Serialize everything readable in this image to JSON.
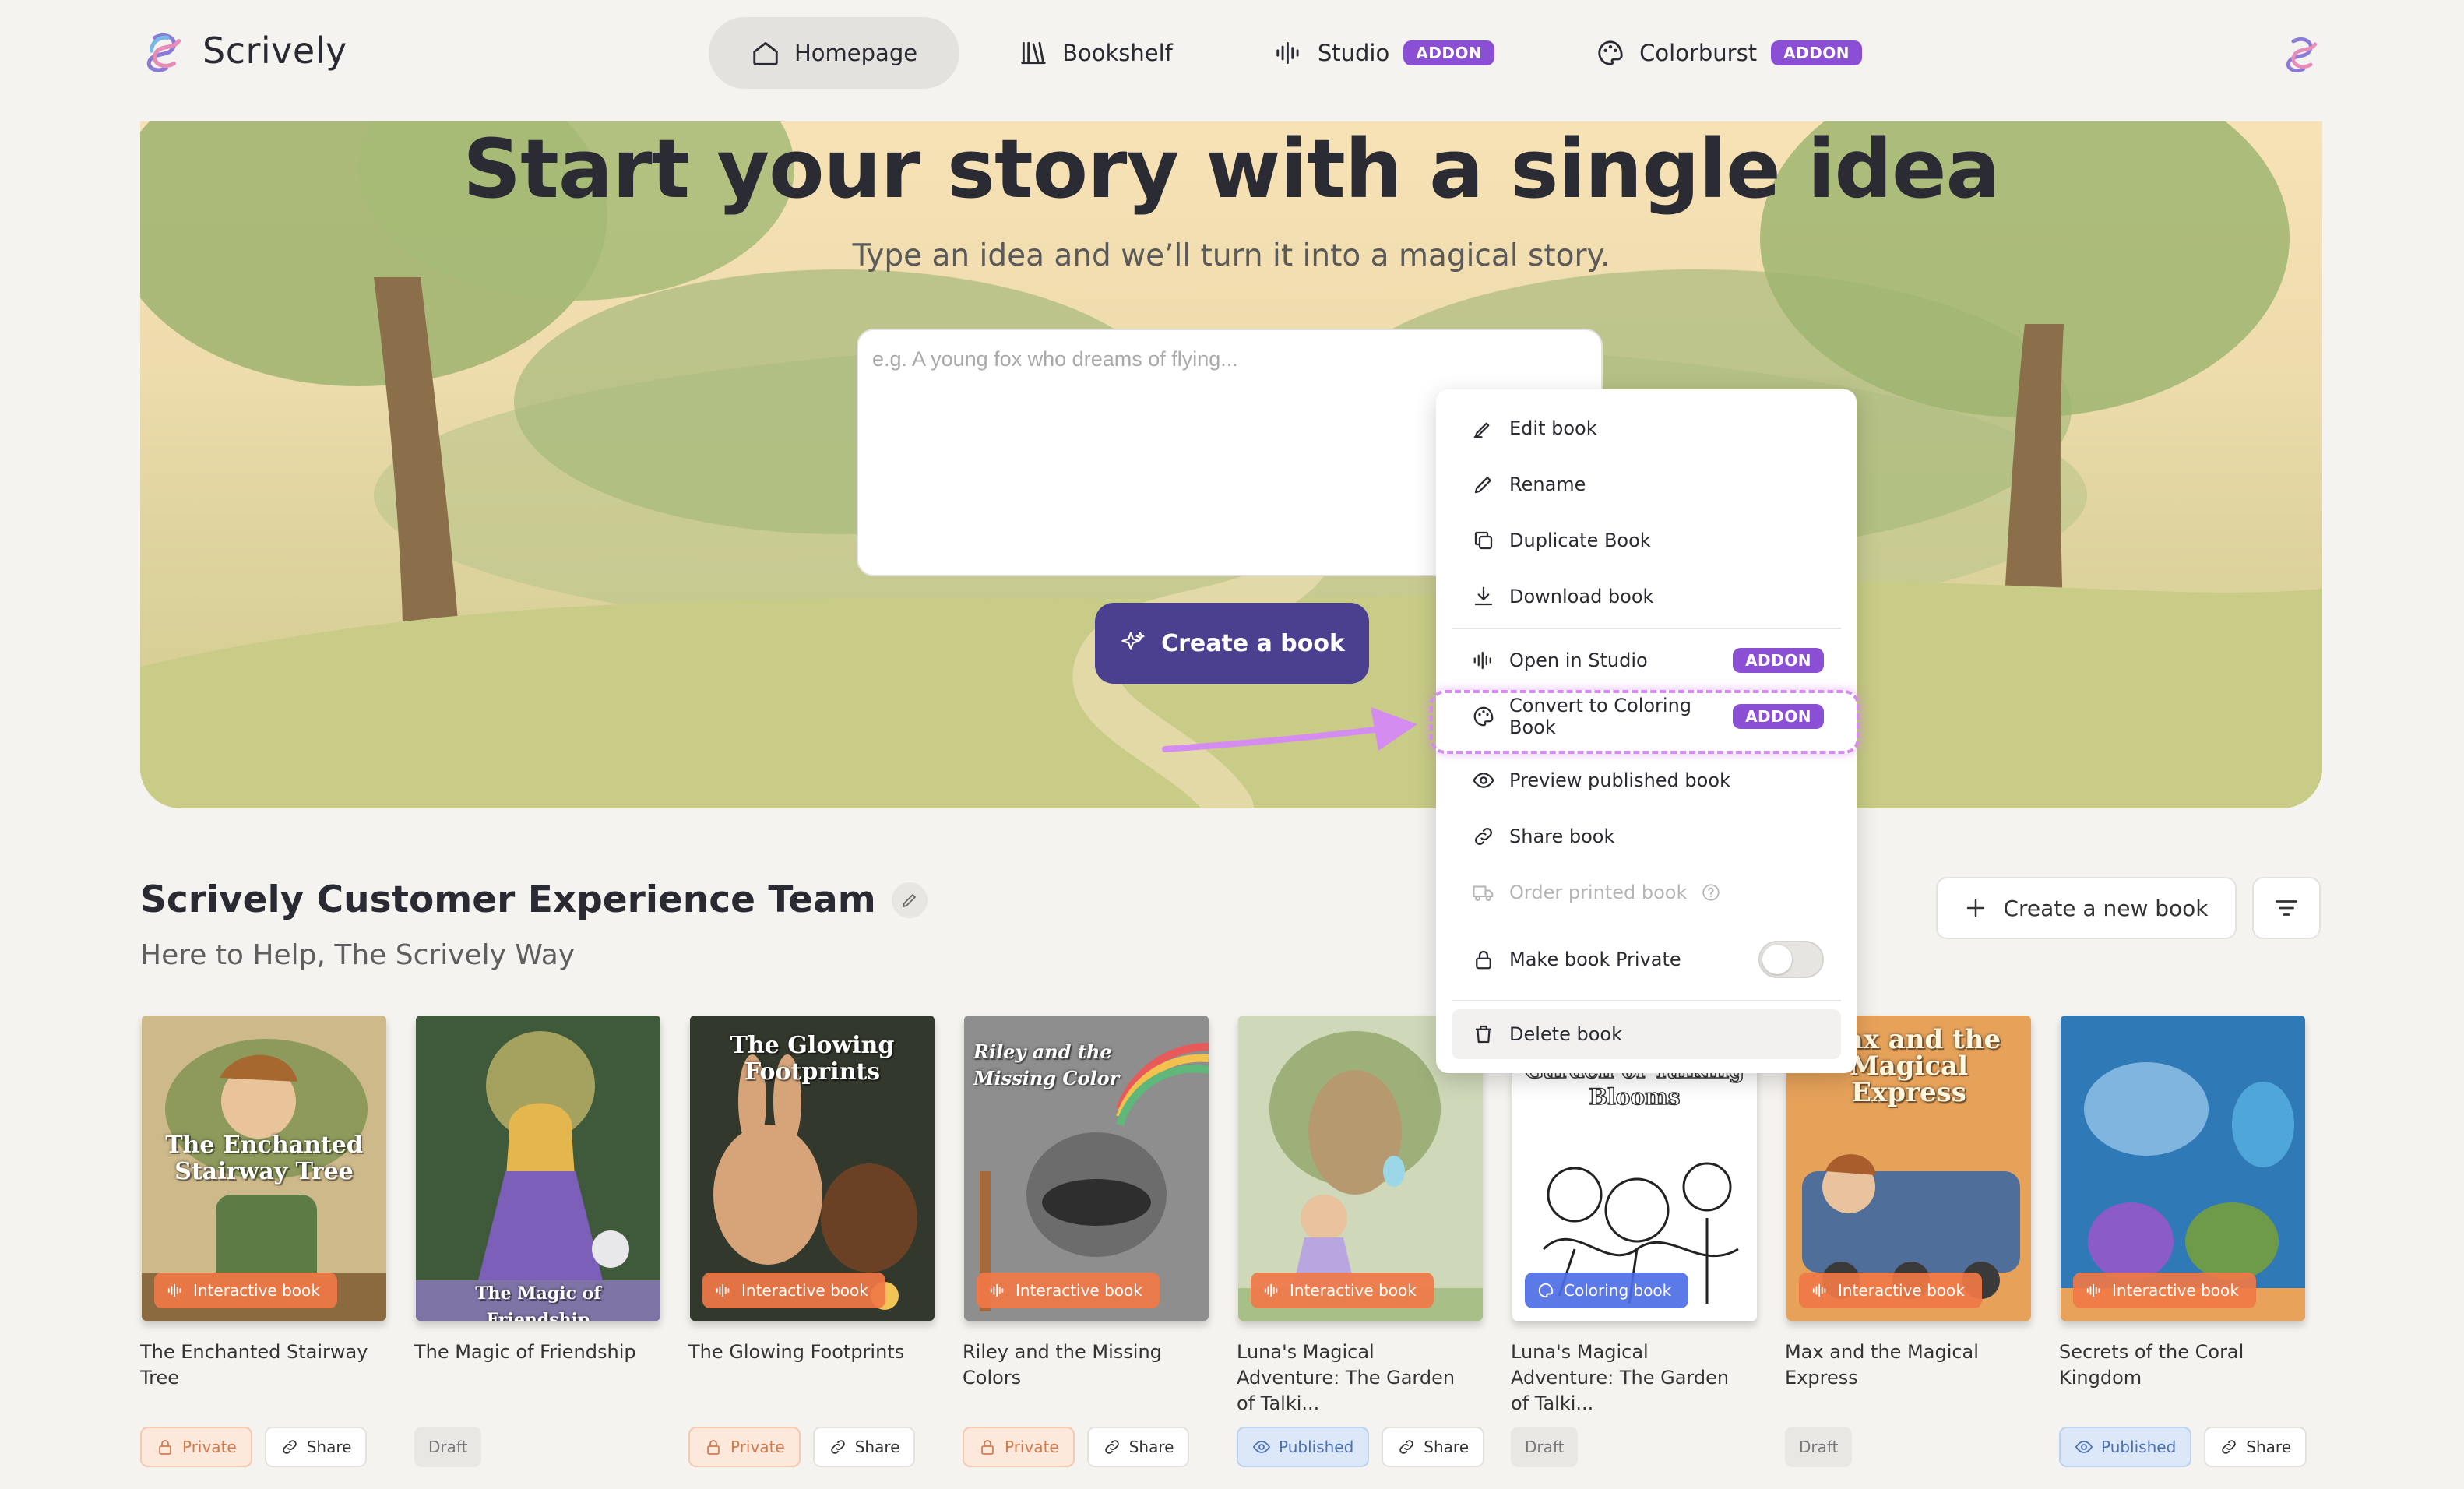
{
  "app": {
    "name": "Scrively"
  },
  "nav": {
    "items": [
      {
        "label": "Homepage",
        "badge": ""
      },
      {
        "label": "Bookshelf",
        "badge": ""
      },
      {
        "label": "Studio",
        "badge": "ADDON"
      },
      {
        "label": "Colorburst",
        "badge": "ADDON"
      }
    ]
  },
  "hero": {
    "title": "Start your story with a single idea",
    "subtitle": "Type an idea and we’ll turn it into a magical story.",
    "idea_placeholder": "e.g. A young fox who dreams of flying...",
    "create_label": "Create a book"
  },
  "section": {
    "title": "Scrively Customer Experience Team",
    "subtitle": "Here to Help, The Scrively Way",
    "new_book_label": "Create a new book"
  },
  "menu": {
    "items": [
      {
        "label": "Edit book",
        "icon": "edit-book-icon"
      },
      {
        "label": "Rename",
        "icon": "pencil-icon"
      },
      {
        "label": "Duplicate Book",
        "icon": "copy-icon"
      },
      {
        "label": "Download book",
        "icon": "download-icon"
      },
      {
        "label": "Open in Studio",
        "icon": "audio-wave-icon",
        "badge": "ADDON"
      },
      {
        "label": "Convert to Coloring Book",
        "icon": "palette-icon",
        "badge": "ADDON"
      },
      {
        "label": "Preview published book",
        "icon": "eye-icon"
      },
      {
        "label": "Share book",
        "icon": "link-icon"
      },
      {
        "label": "Order printed book",
        "icon": "truck-icon",
        "disabled": true
      },
      {
        "label": "Make book Private",
        "icon": "lock-icon",
        "toggle": false
      },
      {
        "label": "Delete book",
        "icon": "trash-icon"
      }
    ]
  },
  "books": [
    {
      "title": "The Enchanted Stairway Tree",
      "cover_text": "The Enchanted Stairway Tree",
      "type": "Interactive book",
      "status": "Private",
      "share": "Share"
    },
    {
      "title": "The Magic of Friendship",
      "cover_text": "The Magic of Friendship",
      "type": "",
      "status": "Draft",
      "share": ""
    },
    {
      "title": "The Glowing Footprints",
      "cover_text": "The Glowing Footprints",
      "type": "Interactive book",
      "status": "Private",
      "share": "Share"
    },
    {
      "title": "Riley and the Missing Colors",
      "cover_text": "Riley and the Missing Color",
      "type": "Interactive book",
      "status": "Private",
      "share": "Share"
    },
    {
      "title": "Luna's Magical Adventure: The Garden of Talki...",
      "cover_text": "",
      "type": "Interactive book",
      "status": "Published",
      "share": "Share"
    },
    {
      "title": "Luna's Magical Adventure: The Garden of Talki...",
      "cover_text": "Adventures The Garden of Talking Blooms",
      "type": "Coloring book",
      "status": "Draft",
      "share": ""
    },
    {
      "title": "Max and the Magical Express",
      "cover_text": "Max and the Magical Express",
      "type": "Interactive book",
      "status": "Draft",
      "share": ""
    },
    {
      "title": "Secrets of the Coral Kingdom",
      "cover_text": "",
      "type": "Interactive book",
      "status": "Published",
      "share": "Share"
    }
  ],
  "colors": {
    "accent": "#4b3f8f",
    "addon": "#8b4fd6",
    "interactive_badge": "#f07846",
    "coloring_badge": "#4e6ee6",
    "highlight": "#d58cf0"
  }
}
